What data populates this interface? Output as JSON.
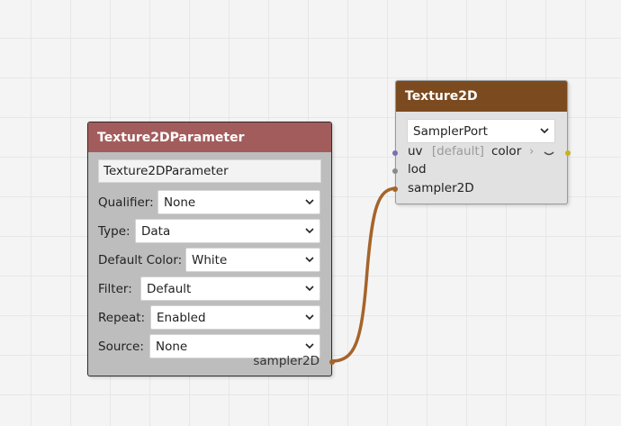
{
  "wire_color": "#a5642a",
  "param_node": {
    "title": "Texture2DParameter",
    "header_color": "#a35c5c",
    "name_value": "Texture2DParameter",
    "fields": [
      {
        "label": "Qualifier:",
        "value": "None"
      },
      {
        "label": "Type:",
        "value": "Data"
      },
      {
        "label": "Default Color:",
        "value": "White"
      },
      {
        "label": "Filter:",
        "value": "Default"
      },
      {
        "label": "Repeat:",
        "value": "Enabled"
      },
      {
        "label": "Source:",
        "value": "None"
      }
    ],
    "output_label": "sampler2D"
  },
  "texture_node": {
    "title": "Texture2D",
    "header_color": "#7b4a1f",
    "sampler_select": "SamplerPort",
    "inputs": {
      "uv": "uv",
      "uv_default": "[default]",
      "lod": "lod",
      "sampler": "sampler2D"
    },
    "output_label": "color",
    "output_arrow": "›",
    "collapse_icon": "chevron-down-icon"
  }
}
